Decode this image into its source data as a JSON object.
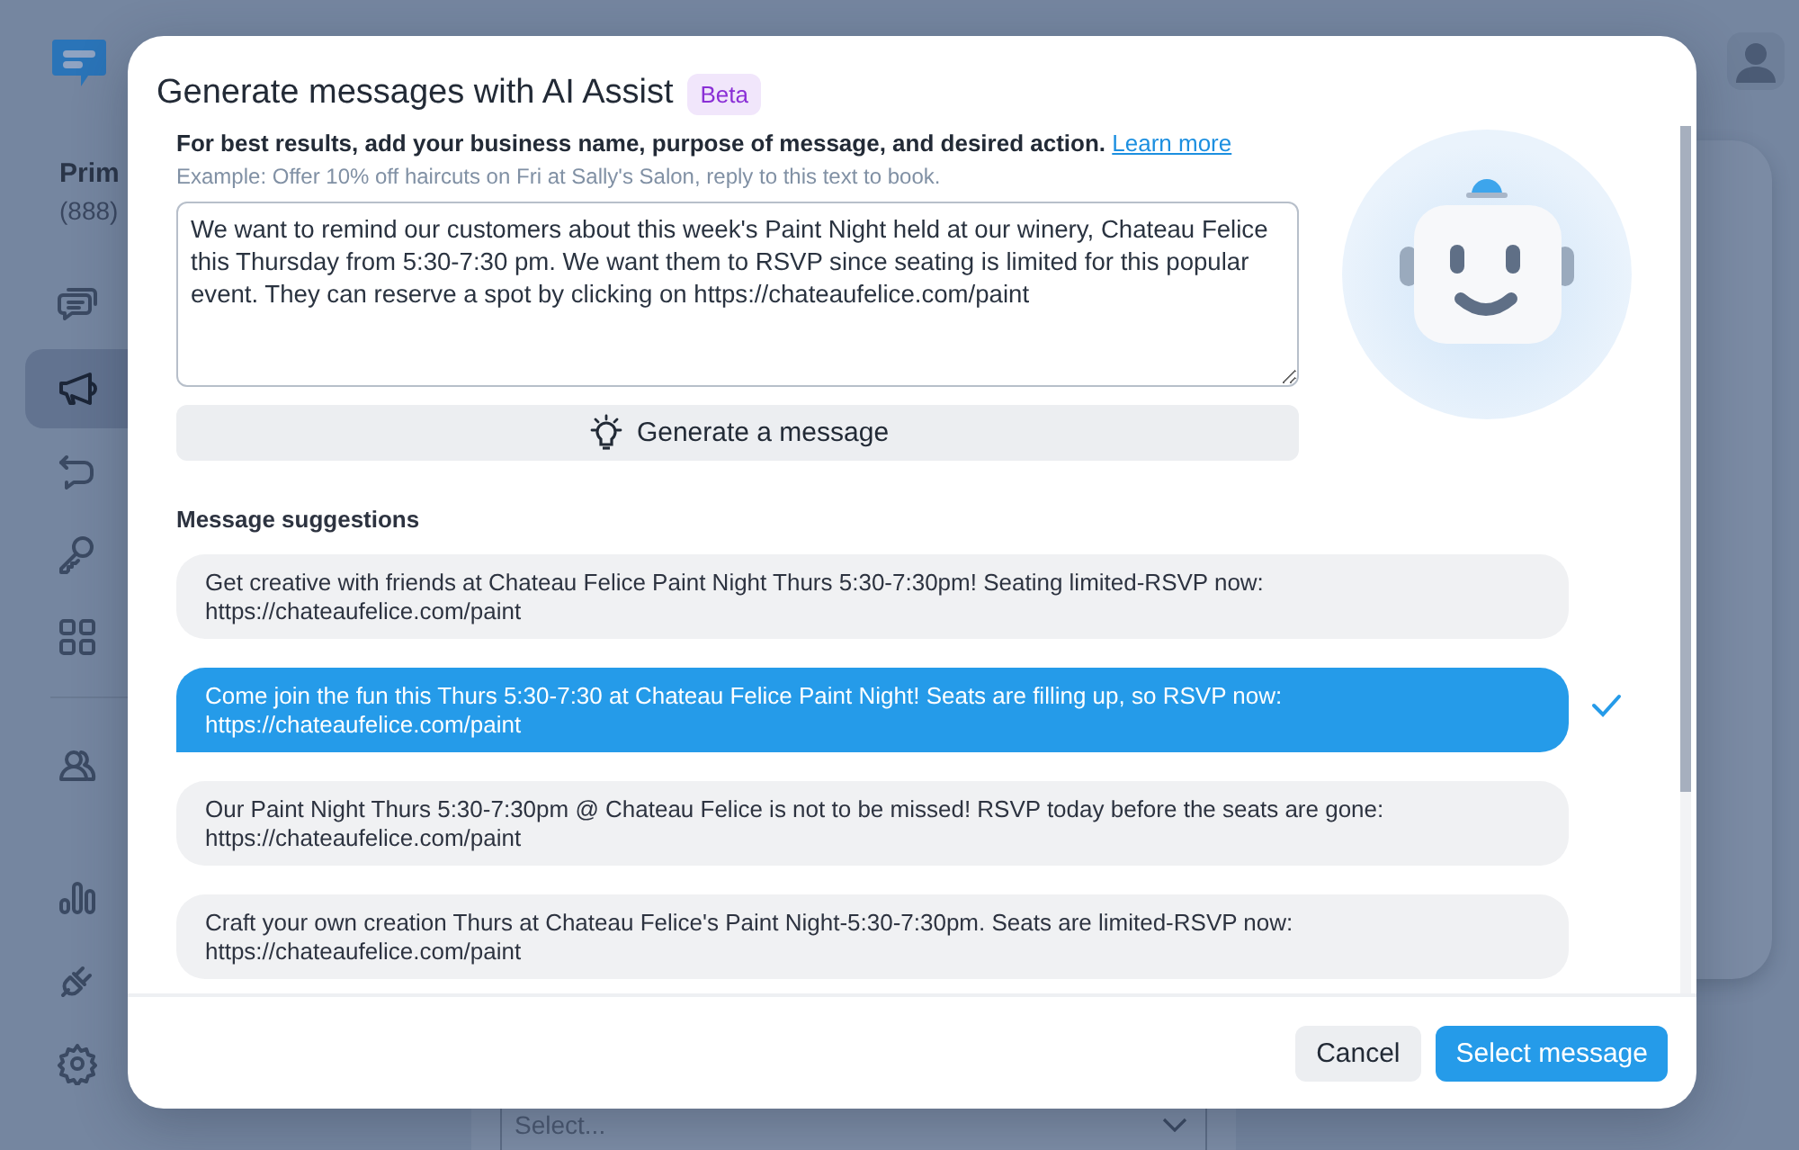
{
  "app": {
    "account_name": "Prim",
    "account_phone": "(888)",
    "nav_items": [
      {
        "selected": false
      },
      {
        "selected": true
      },
      {
        "selected": false
      },
      {
        "selected": false
      },
      {
        "selected": false
      },
      {
        "selected": false
      },
      {
        "selected": false
      },
      {
        "selected": false
      }
    ],
    "select_field": {
      "placeholder": "Select..."
    }
  },
  "dialog": {
    "title": "Generate messages with AI Assist",
    "badge": "Beta",
    "intro": "For best results, add your business name, purpose of message, and desired action.",
    "learn_more_link": "Learn more",
    "example": "Example: Offer 10% off haircuts on Fri at Sally's Salon, reply to this text to book.",
    "prompt": "We want to remind our customers about this week's Paint Night held at our winery, Chateau Felice this Thursday from 5:30-7:30 pm. We want them to RSVP since seating is limited for this popular event. They can reserve a spot by clicking on https://chateaufelice.com/paint",
    "generate_button": "Generate a message",
    "suggestions_heading": "Message suggestions",
    "suggestions": [
      {
        "text": "Get creative with friends at Chateau Felice Paint Night Thurs 5:30-7:30pm! Seating limited-RSVP now: https://chateaufelice.com/paint",
        "selected": false
      },
      {
        "text": "Come join the fun this Thurs 5:30-7:30 at Chateau Felice Paint Night! Seats are filling up, so RSVP now: https://chateaufelice.com/paint",
        "selected": true
      },
      {
        "text": "Our Paint Night Thurs 5:30-7:30pm @ Chateau Felice is not to be missed! RSVP today before the seats are gone: https://chateaufelice.com/paint",
        "selected": false
      },
      {
        "text": "Craft your own creation Thurs at Chateau Felice's Paint Night-5:30-7:30pm. Seats are limited-RSVP now: https://chateaufelice.com/paint",
        "selected": false
      }
    ],
    "cancel_button": "Cancel",
    "select_button": "Select message"
  }
}
